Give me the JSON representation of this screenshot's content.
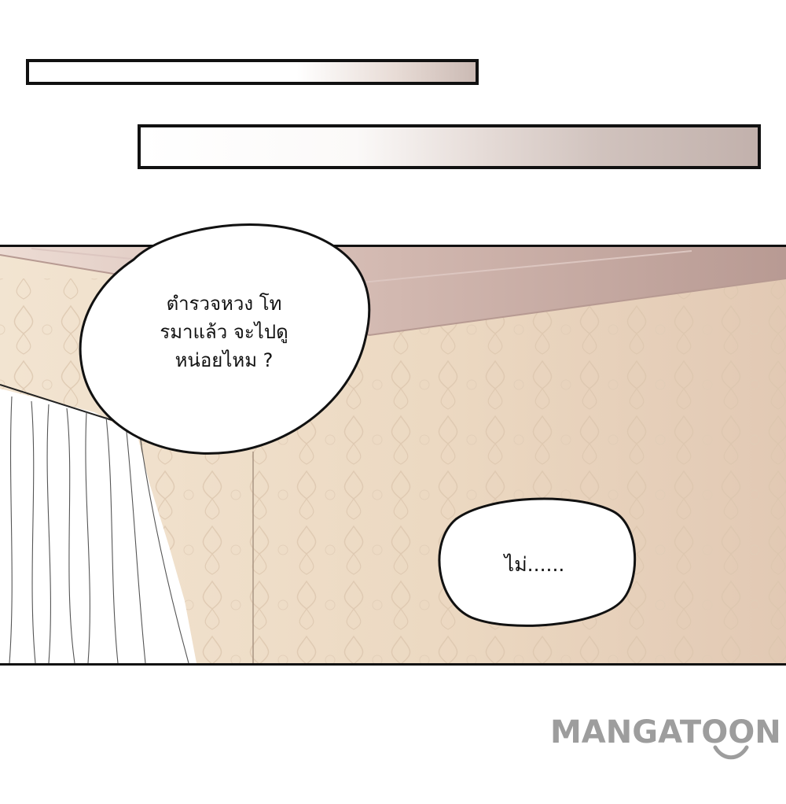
{
  "page": {
    "background": "#ffffff"
  },
  "bubbles": {
    "first": {
      "lines": [
        "ตำรวจหวง โท",
        "รมาแล้ว จะไปดู",
        "หน่อยไหม ?"
      ]
    },
    "second": {
      "text": "ไม่......"
    }
  },
  "watermark": {
    "text": "MANGATOON",
    "color": "#9d9d9d"
  },
  "colors": {
    "wall": "#efe0cc",
    "ceiling": "#c9aaa4",
    "curtain": "#ffffff",
    "ink": "#111111"
  }
}
